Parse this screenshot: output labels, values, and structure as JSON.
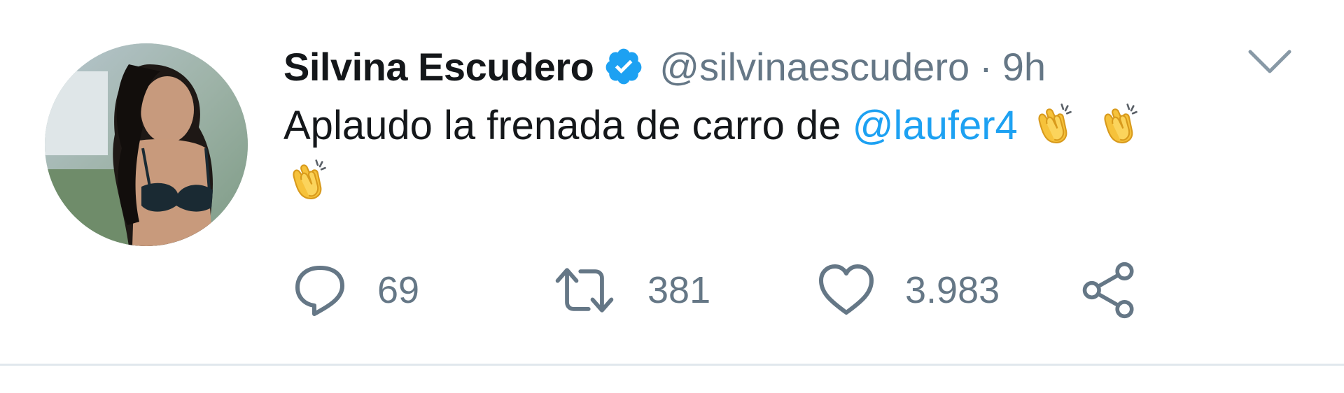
{
  "tweet": {
    "display_name": "Silvina Escudero",
    "handle": "@silvinaescudero",
    "separator": "·",
    "time": "9h",
    "text_before": "Aplaudo la frenada de carro de ",
    "mention": "@laufer4",
    "emoji": "clapping-hands-emoji",
    "emoji_count": 3
  },
  "actions": {
    "reply_count": "69",
    "retweet_count": "381",
    "like_count": "3.983"
  },
  "colors": {
    "text": "#14171a",
    "secondary": "#657786",
    "link": "#1da1f2",
    "verified": "#1da1f2",
    "divider": "#e1e8ed"
  },
  "icons": {
    "verified": "verified-badge-icon",
    "caret": "chevron-down-icon",
    "reply": "reply-icon",
    "retweet": "retweet-icon",
    "like": "heart-icon",
    "share": "share-icon"
  }
}
